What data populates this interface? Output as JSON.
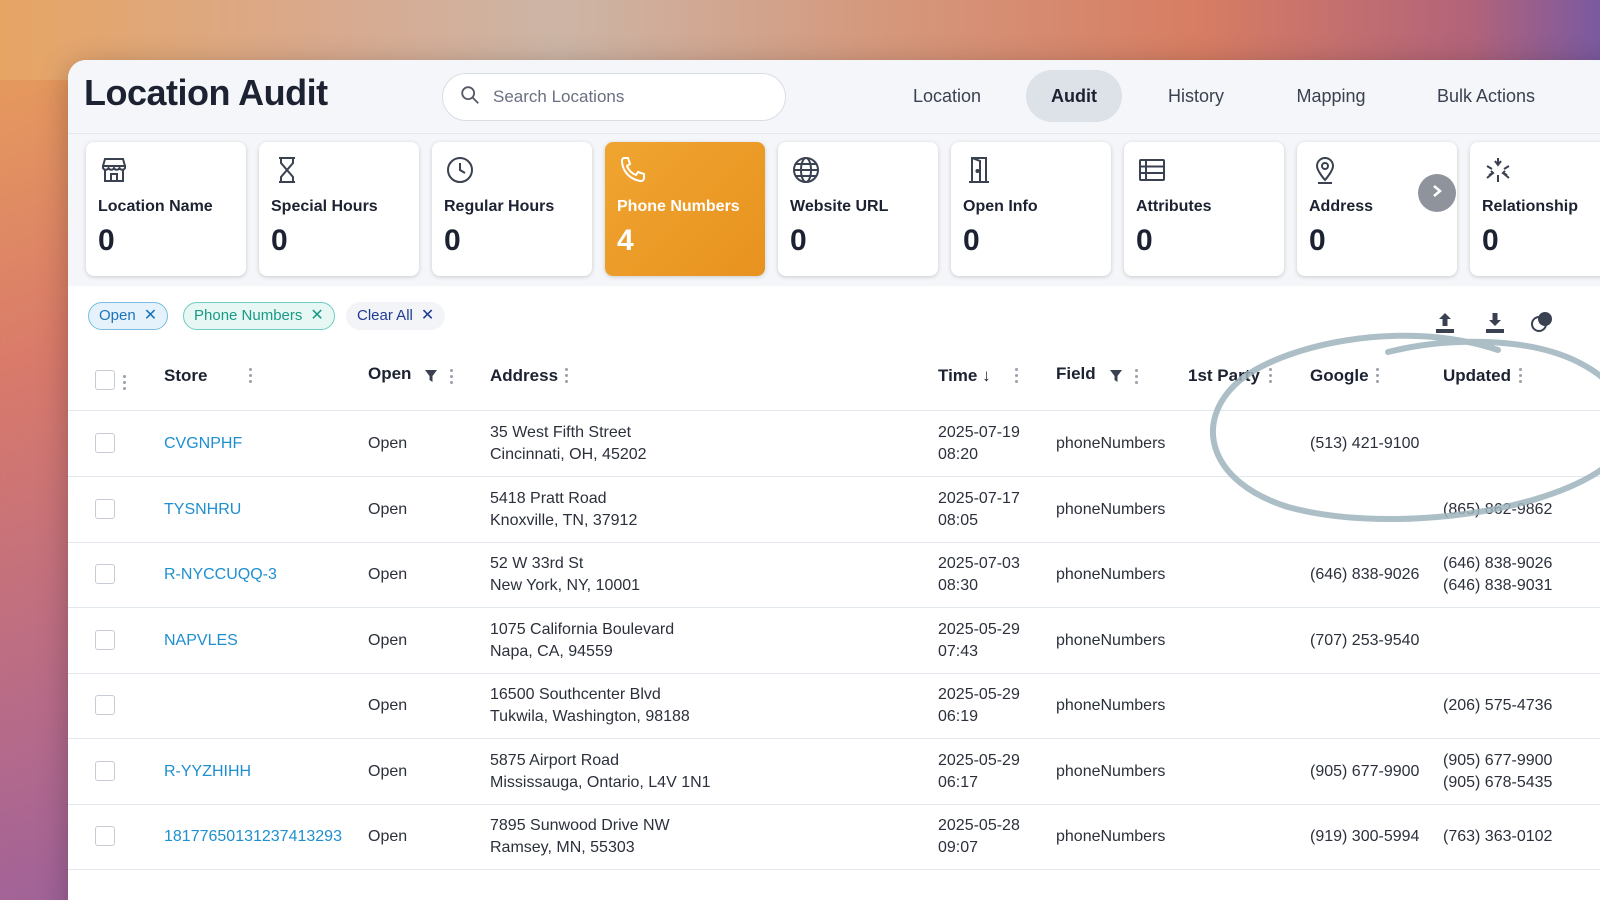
{
  "app": {
    "title": "Location Audit"
  },
  "search": {
    "placeholder": "Search Locations"
  },
  "tabs": [
    {
      "label": "Location"
    },
    {
      "label": "Audit"
    },
    {
      "label": "History"
    },
    {
      "label": "Mapping"
    },
    {
      "label": "Bulk Actions"
    }
  ],
  "active_tab": "Audit",
  "cards": [
    {
      "label": "Location Name",
      "count": "0",
      "icon": "storefront-icon"
    },
    {
      "label": "Special Hours",
      "count": "0",
      "icon": "hourglass-icon"
    },
    {
      "label": "Regular Hours",
      "count": "0",
      "icon": "clock-icon"
    },
    {
      "label": "Phone Numbers",
      "count": "4",
      "icon": "phone-icon"
    },
    {
      "label": "Website URL",
      "count": "0",
      "icon": "globe-icon"
    },
    {
      "label": "Open Info",
      "count": "0",
      "icon": "door-icon"
    },
    {
      "label": "Attributes",
      "count": "0",
      "icon": "list-icon"
    },
    {
      "label": "Address",
      "count": "0",
      "icon": "map-pin-icon"
    },
    {
      "label": "Relationship",
      "count": "0",
      "icon": "relationship-icon"
    }
  ],
  "active_card": "Phone Numbers",
  "filters": {
    "chips": [
      {
        "label": "Open"
      },
      {
        "label": "Phone Numbers"
      }
    ],
    "clear_label": "Clear All",
    "remove_glyph": "✕"
  },
  "table": {
    "columns": [
      {
        "label": "Store"
      },
      {
        "label": "Open"
      },
      {
        "label": "Address"
      },
      {
        "label": "Time",
        "sort": "desc"
      },
      {
        "label": "Field"
      },
      {
        "label": "1st Party"
      },
      {
        "label": "Google"
      },
      {
        "label": "Updated"
      }
    ],
    "sort_glyph": "↓",
    "rows": [
      {
        "store": "CVGNPHF",
        "open": "Open",
        "address_line1": "35 West Fifth Street",
        "address_line2": "Cincinnati, OH, 45202",
        "date": "2025-07-19",
        "time": "08:20",
        "field": "phoneNumbers",
        "first_party": "",
        "google": "(513) 421-9100",
        "updated1": "",
        "updated2": ""
      },
      {
        "store": "TYSNHRU",
        "open": "Open",
        "address_line1": "5418 Pratt Road",
        "address_line2": "Knoxville, TN, 37912",
        "date": "2025-07-17",
        "time": "08:05",
        "field": "phoneNumbers",
        "first_party": "",
        "google": "",
        "updated1": "(865) 862-9862",
        "updated2": ""
      },
      {
        "store": "R-NYCCUQQ-3",
        "open": "Open",
        "address_line1": "52 W 33rd St",
        "address_line2": "New York, NY, 10001",
        "date": "2025-07-03",
        "time": "08:30",
        "field": "phoneNumbers",
        "first_party": "",
        "google": "(646) 838-9026",
        "updated1": "(646) 838-9026",
        "updated2": "(646) 838-9031"
      },
      {
        "store": "NAPVLES",
        "open": "Open",
        "address_line1": "1075 California Boulevard",
        "address_line2": "Napa, CA, 94559",
        "date": "2025-05-29",
        "time": "07:43",
        "field": "phoneNumbers",
        "first_party": "",
        "google": "(707) 253-9540",
        "updated1": "",
        "updated2": ""
      },
      {
        "store": "",
        "open": "Open",
        "address_line1": "16500 Southcenter Blvd",
        "address_line2": "Tukwila, Washington, 98188",
        "date": "2025-05-29",
        "time": "06:19",
        "field": "phoneNumbers",
        "first_party": "",
        "google": "",
        "updated1": "(206) 575-4736",
        "updated2": ""
      },
      {
        "store": "R-YYZHIHH",
        "open": "Open",
        "address_line1": "5875 Airport Road",
        "address_line2": "Mississauga, Ontario, L4V 1N1",
        "date": "2025-05-29",
        "time": "06:17",
        "field": "phoneNumbers",
        "first_party": "",
        "google": "(905) 677-9900",
        "updated1": "(905) 677-9900",
        "updated2": "(905) 678-5435"
      },
      {
        "store": "18177650131237413293",
        "open": "Open",
        "address_line1": "7895 Sunwood Drive NW",
        "address_line2": "Ramsey, MN, 55303",
        "date": "2025-05-28",
        "time": "09:07",
        "field": "phoneNumbers",
        "first_party": "",
        "google": "(919) 300-5994",
        "updated1": "(763) 363-0102",
        "updated2": ""
      }
    ]
  },
  "toolbar_icons": [
    "upload-icon",
    "download-icon",
    "settings-icon"
  ],
  "colors": {
    "accent_orange": "#f0a531",
    "link_blue": "#1e8fd0",
    "chip_open": "#1a73b8",
    "chip_phone": "#199a86",
    "clear_all": "#1f3a93",
    "annotation": "#9fb4bc"
  }
}
